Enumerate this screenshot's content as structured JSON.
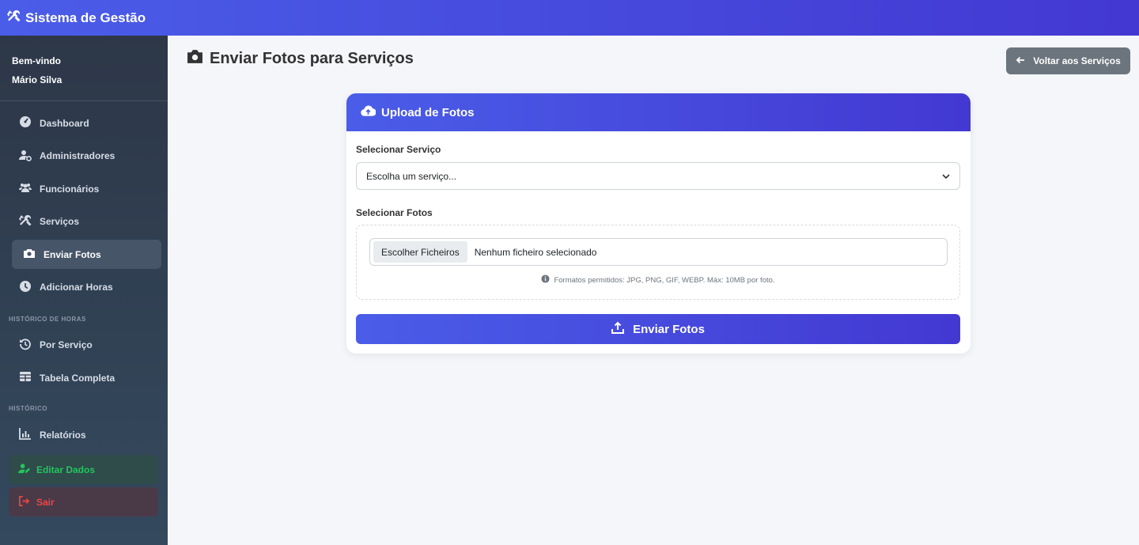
{
  "app": {
    "title": "Sistema de Gestão",
    "accent": "#4a5de8",
    "accent_dark": "#4338d2"
  },
  "sidebar": {
    "welcome_label": "Bem-vindo",
    "user_name": "Mário Silva",
    "items": [
      {
        "label": "Dashboard",
        "icon": "gauge-icon"
      },
      {
        "label": "Administradores",
        "icon": "user-gear-icon"
      },
      {
        "label": "Funcionários",
        "icon": "users-icon"
      },
      {
        "label": "Serviços",
        "icon": "tools-icon"
      },
      {
        "label": "Enviar Fotos",
        "icon": "camera-icon",
        "active": true
      },
      {
        "label": "Adicionar Horas",
        "icon": "clock-icon"
      }
    ],
    "section_hours": "HISTÓRICO DE HORAS",
    "hours_items": [
      {
        "label": "Por Serviço",
        "icon": "history-icon"
      },
      {
        "label": "Tabela Completa",
        "icon": "table-icon"
      }
    ],
    "section_history": "HISTÓRICO",
    "history_items": [
      {
        "label": "Relatórios",
        "icon": "chart-icon"
      }
    ],
    "edit_label": "Editar Dados",
    "logout_label": "Sair",
    "edit_color": "#22c55e",
    "logout_color": "#ef4444"
  },
  "main": {
    "title": "Enviar Fotos para Serviços",
    "back_label": "Voltar aos Serviços",
    "card": {
      "header": "Upload de Fotos",
      "service_label": "Selecionar Serviço",
      "service_placeholder": "Escolha um serviço...",
      "photos_label": "Selecionar Fotos",
      "file_button": "Escolher Ficheiros",
      "file_status": "Nenhum ficheiro selecionado",
      "hint": "Formatos permitidos: JPG, PNG, GIF, WEBP. Máx: 10MB por foto.",
      "submit_label": "Enviar Fotos"
    }
  }
}
